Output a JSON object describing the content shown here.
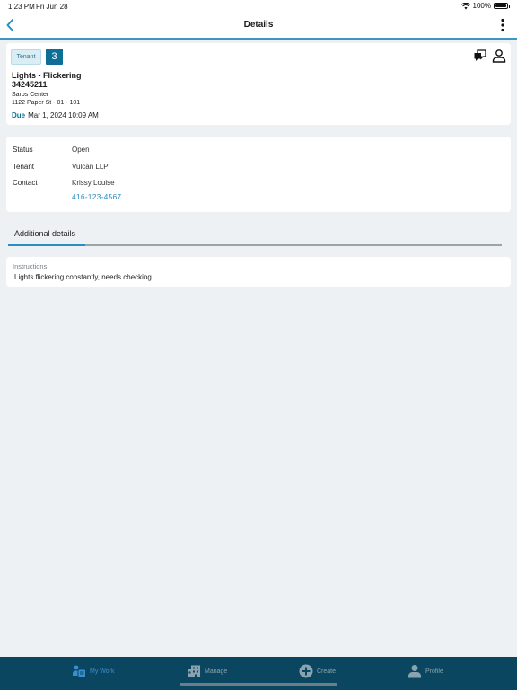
{
  "status_bar": {
    "time": "1:23 PM",
    "date": "Fri Jun 28",
    "battery": "100%"
  },
  "nav": {
    "title": "Details"
  },
  "work_order": {
    "tenant_badge": "Tenant",
    "count": "3",
    "title": "Lights - Flickering",
    "number": "34245211",
    "site_name": "Saros Center",
    "site_address": "1122 Paper St - 01 - 101",
    "due_label": "Due",
    "due_date": "Mar 1, 2024 10:09 AM"
  },
  "info": {
    "status_label": "Status",
    "status_value": "Open",
    "tenant_label": "Tenant",
    "tenant_value": "Vulcan LLP",
    "contact_label": "Contact",
    "contact_value": "Krissy Louise",
    "contact_phone": "416-123-4567"
  },
  "tabs": {
    "additional_details": "Additional details"
  },
  "instructions": {
    "label": "Instructions",
    "text": "Lights flickering constantly, needs checking"
  },
  "bottom_tabs": [
    {
      "label": "My Work",
      "icon": "my-work-icon",
      "active": true
    },
    {
      "label": "Manage",
      "icon": "building-icon",
      "active": false
    },
    {
      "label": "Create",
      "icon": "plus-circle-icon",
      "active": false
    },
    {
      "label": "Profile",
      "icon": "person-icon",
      "active": false
    }
  ],
  "colors": {
    "accent": "#3f96c6",
    "brand_dark": "#0b4661",
    "badge": "#0d6f96",
    "link": "#2b8fc4"
  }
}
